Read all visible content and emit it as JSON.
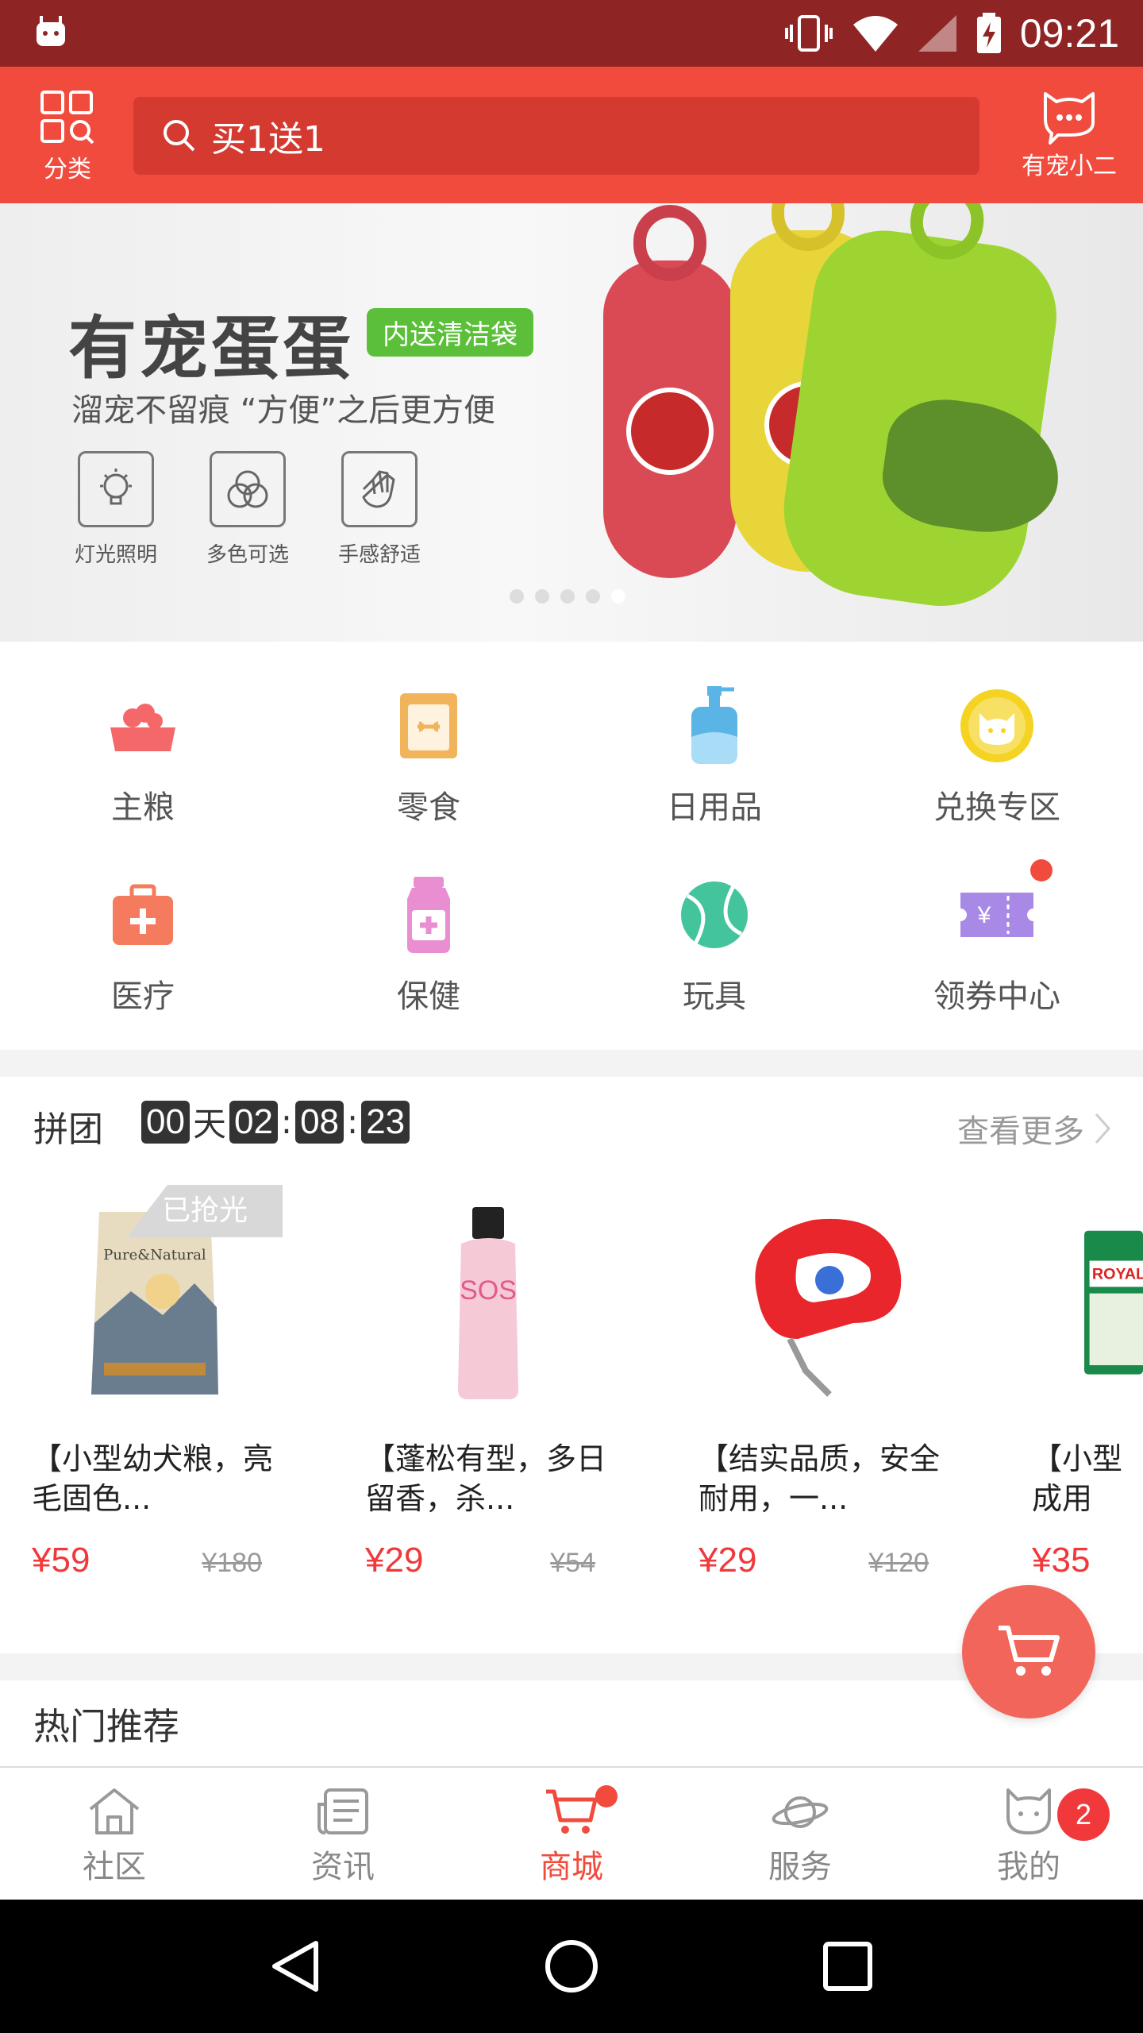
{
  "status_bar": {
    "time": "09:21"
  },
  "header": {
    "category_label": "分类",
    "search_value": "买1送1",
    "service_label": "有宠小二"
  },
  "banner": {
    "title": "有宠蛋蛋",
    "tag": "内送清洁袋",
    "subtitle": "溜宠不留痕 “方便”之后更方便",
    "features": [
      "灯光照明",
      "多色可选",
      "手感舒适"
    ],
    "slide_count": 5,
    "active_slide": 5
  },
  "categories": [
    {
      "label": "主粮",
      "icon": "food-bowl-icon",
      "color": "#f4686a"
    },
    {
      "label": "零食",
      "icon": "snack-bag-icon",
      "color": "#f2b45a"
    },
    {
      "label": "日用品",
      "icon": "shampoo-bottle-icon",
      "color": "#5ab4e6"
    },
    {
      "label": "兑换专区",
      "icon": "cat-coin-icon",
      "color": "#f5d322"
    },
    {
      "label": "医疗",
      "icon": "medical-kit-icon",
      "color": "#f47b5e"
    },
    {
      "label": "保健",
      "icon": "health-bottle-icon",
      "color": "#e98fd1"
    },
    {
      "label": "玩具",
      "icon": "ball-icon",
      "color": "#43c49c"
    },
    {
      "label": "领券中心",
      "icon": "coupon-icon",
      "color": "#a88ae6",
      "coupon_symbol": "¥"
    }
  ],
  "group_buy": {
    "title": "拼团",
    "timer": {
      "days": "00",
      "day_unit": "天",
      "hours": "02",
      "minutes": "08",
      "seconds": "23",
      "sep": ":"
    },
    "more_label": "查看更多",
    "sold_out_label": "已抢光",
    "products": [
      {
        "name": "【小型幼犬粮，亮毛固色...",
        "price": "¥59",
        "original_price": "¥180",
        "sold_out": true,
        "image_text": "Pure&Natural"
      },
      {
        "name": "【蓬松有型，多日留香，杀...",
        "price": "¥29",
        "original_price": "¥54",
        "sold_out": false,
        "image_text": "SOS"
      },
      {
        "name": "【结实品质，安全耐用，一...",
        "price": "¥29",
        "original_price": "¥120",
        "sold_out": false,
        "image_text": ""
      },
      {
        "name": "【小型成用粮，易",
        "price": "¥35",
        "original_price": "",
        "sold_out": false,
        "image_text": "ROYAL"
      }
    ]
  },
  "hot_section": {
    "title": "热门推荐"
  },
  "tab_bar": [
    {
      "label": "社区",
      "icon": "home-icon",
      "active": false
    },
    {
      "label": "资讯",
      "icon": "news-icon",
      "active": false
    },
    {
      "label": "商城",
      "icon": "cart-icon",
      "active": true,
      "dot": true
    },
    {
      "label": "服务",
      "icon": "planet-icon",
      "active": false
    },
    {
      "label": "我的",
      "icon": "cat-profile-icon",
      "active": false,
      "badge": "2"
    }
  ],
  "colors": {
    "brand": "#f14b3e",
    "status_bar": "#8f2424",
    "price": "#f1393c"
  }
}
